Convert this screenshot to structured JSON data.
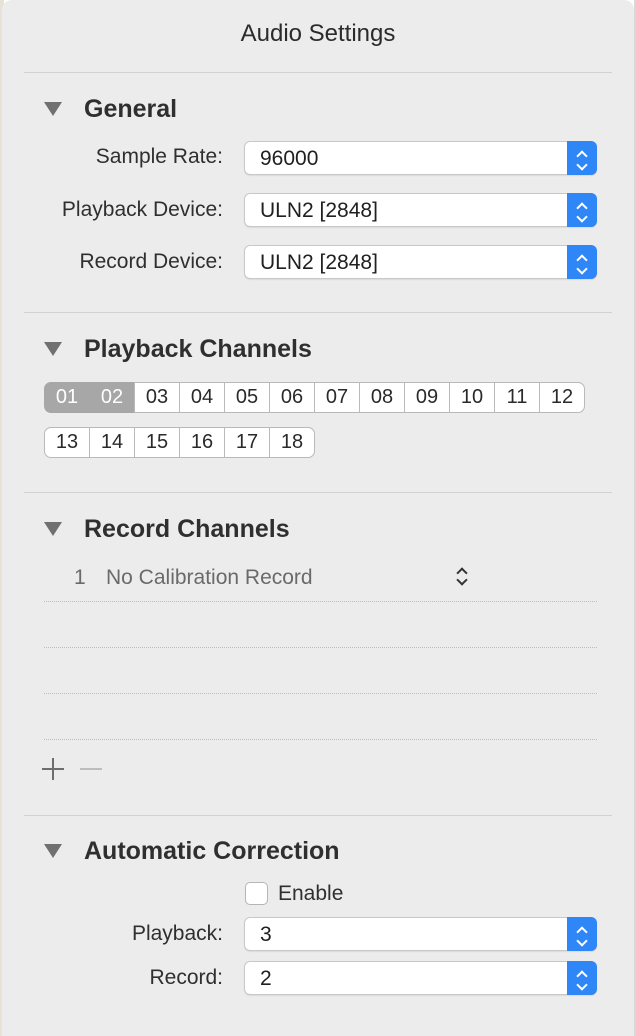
{
  "window": {
    "title": "Audio Settings"
  },
  "general": {
    "title": "General",
    "sample_rate": {
      "label": "Sample Rate:",
      "value": "96000"
    },
    "playback_device": {
      "label": "Playback Device:",
      "value": "ULN2 [2848]"
    },
    "record_device": {
      "label": "Record Device:",
      "value": "ULN2 [2848]"
    }
  },
  "playback_channels": {
    "title": "Playback Channels",
    "row1": [
      {
        "label": "01",
        "selected": true
      },
      {
        "label": "02",
        "selected": true
      },
      {
        "label": "03",
        "selected": false
      },
      {
        "label": "04",
        "selected": false
      },
      {
        "label": "05",
        "selected": false
      },
      {
        "label": "06",
        "selected": false
      },
      {
        "label": "07",
        "selected": false
      },
      {
        "label": "08",
        "selected": false
      },
      {
        "label": "09",
        "selected": false
      },
      {
        "label": "10",
        "selected": false
      },
      {
        "label": "11",
        "selected": false
      },
      {
        "label": "12",
        "selected": false
      }
    ],
    "row2": [
      {
        "label": "13",
        "selected": false
      },
      {
        "label": "14",
        "selected": false
      },
      {
        "label": "15",
        "selected": false
      },
      {
        "label": "16",
        "selected": false
      },
      {
        "label": "17",
        "selected": false
      },
      {
        "label": "18",
        "selected": false
      }
    ]
  },
  "record_channels": {
    "title": "Record Channels",
    "rows": [
      {
        "number": "1",
        "name": "No Calibration Record"
      }
    ]
  },
  "automatic_correction": {
    "title": "Automatic Correction",
    "enable": {
      "label": "Enable",
      "checked": false
    },
    "playback": {
      "label": "Playback:",
      "value": "3"
    },
    "record": {
      "label": "Record:",
      "value": "2"
    }
  },
  "colors": {
    "panel_bg": "#ececec",
    "accent": "#2f86f6",
    "selected_channel": "#a7a7a7"
  }
}
